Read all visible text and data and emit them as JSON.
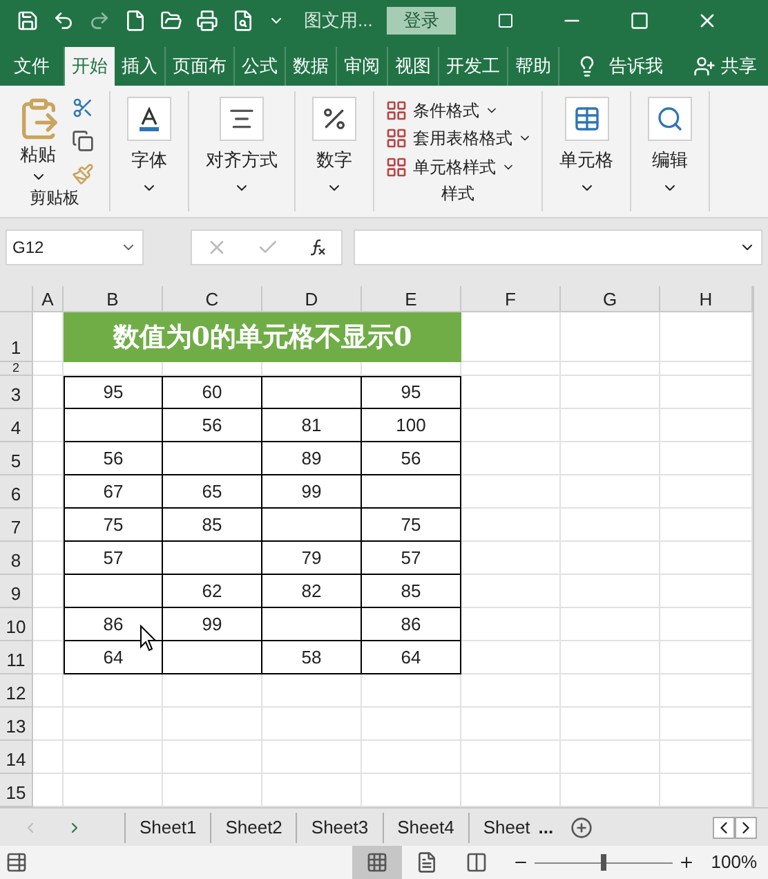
{
  "title_bar": {
    "document": "图文用...",
    "login": "登录"
  },
  "ribbon_tabs": [
    {
      "label": "文件",
      "selected": false
    },
    {
      "label": "开始",
      "selected": true
    },
    {
      "label": "插入",
      "selected": false
    },
    {
      "label": "页面布",
      "selected": false
    },
    {
      "label": "公式",
      "selected": false
    },
    {
      "label": "数据",
      "selected": false
    },
    {
      "label": "审阅",
      "selected": false
    },
    {
      "label": "视图",
      "selected": false
    },
    {
      "label": "开发工",
      "selected": false
    },
    {
      "label": "帮助",
      "selected": false
    }
  ],
  "tell_me": "告诉我",
  "share": "共享",
  "ribbon_groups": [
    {
      "kind": "clipboard",
      "button": "粘贴",
      "label": "剪贴板"
    },
    {
      "kind": "font",
      "button": "字体"
    },
    {
      "kind": "alignment",
      "button": "对齐方式"
    },
    {
      "kind": "number",
      "button": "数字"
    },
    {
      "kind": "styles",
      "items": [
        "条件格式",
        "套用表格格式",
        "单元格样式"
      ],
      "label": "样式"
    },
    {
      "kind": "cells",
      "button": "单元格"
    },
    {
      "kind": "editing",
      "button": "编辑"
    }
  ],
  "name_box": "G12",
  "columns": [
    "A",
    "B",
    "C",
    "D",
    "E",
    "F",
    "G",
    "H"
  ],
  "rows": [
    {
      "header": "1",
      "kind": "title",
      "text": "数值为0的单元格不显示0"
    },
    {
      "header": "2",
      "kind": "spacer"
    },
    {
      "header": "3",
      "kind": "data",
      "cells": [
        "95",
        "60",
        null,
        "95"
      ]
    },
    {
      "header": "4",
      "kind": "data",
      "cells": [
        null,
        "56",
        "81",
        "100"
      ]
    },
    {
      "header": "5",
      "kind": "data",
      "cells": [
        "56",
        null,
        "89",
        "56"
      ]
    },
    {
      "header": "6",
      "kind": "data",
      "cells": [
        "67",
        "65",
        "99",
        null
      ]
    },
    {
      "header": "7",
      "kind": "data",
      "cells": [
        "75",
        "85",
        null,
        "75"
      ]
    },
    {
      "header": "8",
      "kind": "data",
      "cells": [
        "57",
        null,
        "79",
        "57"
      ]
    },
    {
      "header": "9",
      "kind": "data",
      "cells": [
        null,
        "62",
        "82",
        "85"
      ]
    },
    {
      "header": "10",
      "kind": "data",
      "cells": [
        "86",
        "99",
        null,
        "86"
      ]
    },
    {
      "header": "11",
      "kind": "data",
      "cells": [
        "64",
        null,
        "58",
        "64"
      ]
    },
    {
      "header": "12",
      "kind": "blank"
    },
    {
      "header": "13",
      "kind": "blank"
    },
    {
      "header": "14",
      "kind": "blank"
    },
    {
      "header": "15",
      "kind": "blank"
    }
  ],
  "sheet_tabs": [
    {
      "label": "Sheet1",
      "selected": false
    },
    {
      "label": "Sheet2",
      "selected": false
    },
    {
      "label": "Sheet3",
      "selected": false
    },
    {
      "label": "Sheet4",
      "selected": false
    },
    {
      "label": "Sheet",
      "selected": false
    }
  ],
  "more_sheets": "...",
  "views": [
    {
      "kind": "normal",
      "selected": true
    },
    {
      "kind": "page_layout",
      "selected": false
    },
    {
      "kind": "page_break",
      "selected": false
    }
  ],
  "zoom": {
    "level": 0.5,
    "reading": "100%"
  }
}
